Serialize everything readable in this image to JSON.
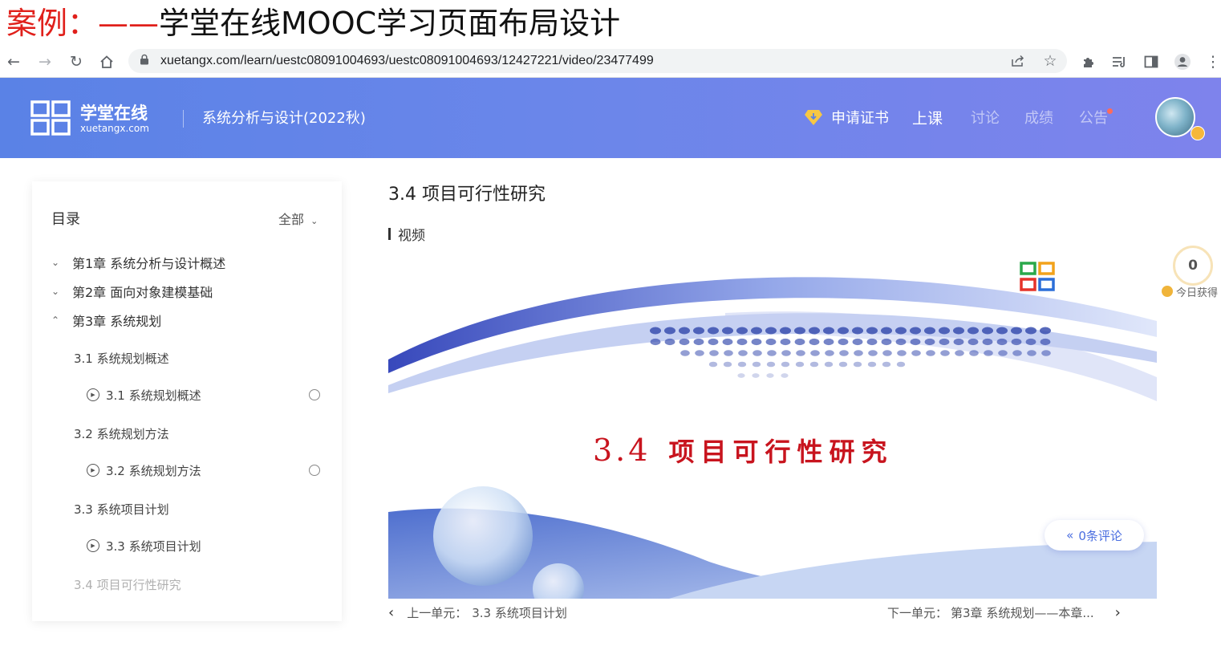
{
  "slide": {
    "title_prefix": "案例：——",
    "title_main": "学堂在线MOOC学习页面布局设计"
  },
  "browser": {
    "url": "xuetangx.com/learn/uestc08091004693/uestc08091004693/12427221/video/23477499"
  },
  "header": {
    "logo_cn": "学堂在线",
    "logo_en": "xuetangx.com",
    "course_name": "系统分析与设计(2022秋)",
    "nav": {
      "certificate": "申请证书",
      "class": "上课",
      "discussion": "讨论",
      "grades": "成绩",
      "announcements": "公告"
    }
  },
  "sidebar": {
    "title": "目录",
    "filter": "全部",
    "chapters": [
      {
        "label": "第1章 系统分析与设计概述",
        "state": "collapsed"
      },
      {
        "label": "第2章 面向对象建模基础",
        "state": "collapsed"
      },
      {
        "label": "第3章 系统规划",
        "state": "expanded"
      }
    ],
    "sections": [
      {
        "label": "3.1 系统规划概述",
        "item": "3.1 系统规划概述"
      },
      {
        "label": "3.2 系统规划方法",
        "item": "3.2 系统规划方法"
      },
      {
        "label": "3.3 系统项目计划",
        "item": "3.3 系统项目计划"
      },
      {
        "label": "3.4 项目可行性研究"
      }
    ]
  },
  "main": {
    "title": "3.4 项目可行性研究",
    "section_label": "视频",
    "video_slide": {
      "number": "3.4",
      "heading": "项目可行性研究"
    },
    "comments": "0条评论",
    "prev": {
      "label": "上一单元：",
      "title": "3.3 系统项目计划"
    },
    "next": {
      "label": "下一单元：",
      "title": "第3章 系统规划——本章..."
    }
  },
  "points": {
    "value": "0",
    "label": "今日获得"
  },
  "colors": {
    "header_start": "#5a82e6",
    "header_end": "#7e83ec",
    "slide_title_red": "#e0201b",
    "video_heading_red": "#c8141e",
    "link_blue": "#4a6ee0"
  }
}
